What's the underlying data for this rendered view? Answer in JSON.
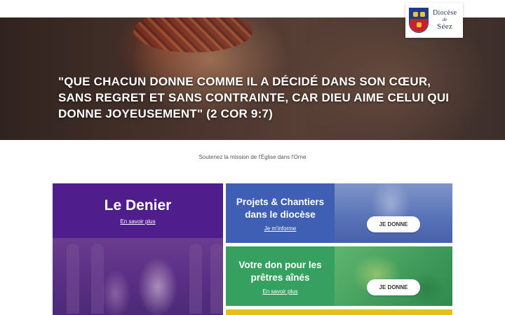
{
  "logo": {
    "line1": "Diocèse",
    "line2": "de",
    "line3": "Séez",
    "colors": {
      "shield_blue": "#1f3b8c",
      "shield_red": "#c8202c",
      "lion_gold": "#f2c230"
    }
  },
  "hero": {
    "quote": "\"QUE CHACUN DONNE COMME IL A DÉCIDÉ DANS SON CŒUR, SANS REGRET ET SANS CONTRAINTE, CAR DIEU AIME CELUI QUI DONNE JOYEUSEMENT\" (2 COR 9:7)"
  },
  "subtitle": "Soutenez la mission de l'Église dans l'Orne",
  "cards": {
    "denier": {
      "title": "Le Denier",
      "link": "En savoir plus",
      "color": "#4f1d8c"
    },
    "projets": {
      "title": "Projets & Chantiers dans le diocèse",
      "link": "Je m'informe",
      "button": "JE DONNE",
      "color": "#3f5fb4"
    },
    "pretres": {
      "title": "Votre don pour les prêtres aînés",
      "link": "En savoir plus",
      "button": "JE DONNE",
      "color": "#35a060"
    },
    "yellow": {
      "color": "#e2c21a"
    }
  }
}
